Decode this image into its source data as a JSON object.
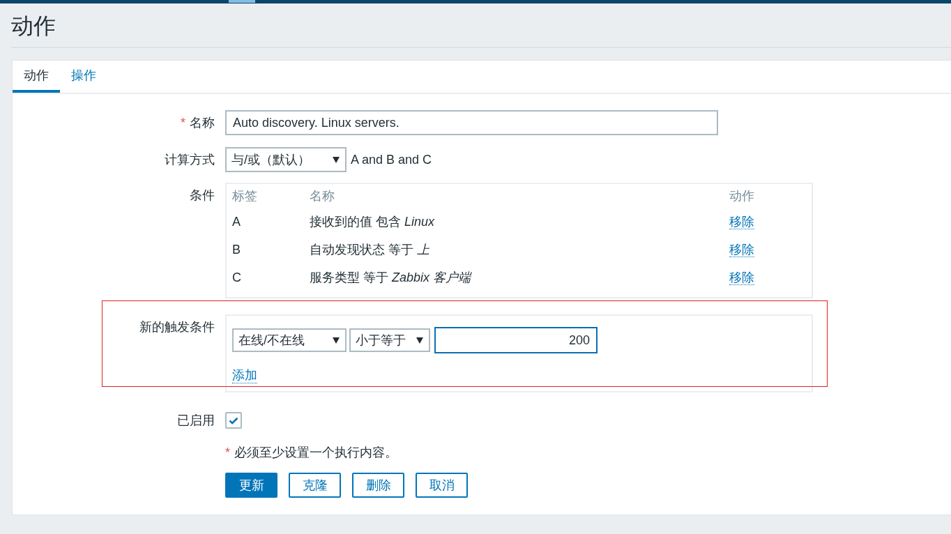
{
  "page_title": "动作",
  "tabs": [
    {
      "label": "动作",
      "selected": true
    },
    {
      "label": "操作",
      "selected": false
    }
  ],
  "form": {
    "name": {
      "required_mark": "*",
      "label": "名称",
      "value": "Auto discovery. Linux servers."
    },
    "calculation": {
      "label": "计算方式",
      "value": "与/或（默认）",
      "formula": "A and B and C"
    },
    "conditions": {
      "label": "条件",
      "columns": [
        "标签",
        "名称",
        "动作"
      ],
      "rows": [
        {
          "label": "A",
          "name": "接收到的值 包含 *Linux*",
          "action": "移除"
        },
        {
          "label": "B",
          "name": "自动发现状态 等于 *上*",
          "action": "移除"
        },
        {
          "label": "C",
          "name": "服务类型 等于 *Zabbix 客户端*",
          "action": "移除"
        }
      ]
    },
    "new_condition": {
      "label": "新的触发条件",
      "highlighted": true,
      "condition_type": "在线/不在线",
      "operator": "小于等于",
      "value": "200",
      "focused": true,
      "add_link": "添加"
    },
    "enabled": {
      "label": "已启用",
      "checked": true
    },
    "note": {
      "mark": "*",
      "text": "必须至少设置一个执行内容。"
    },
    "buttons": [
      {
        "label": "更新",
        "kind": "primary"
      },
      {
        "label": "克隆",
        "kind": "secondary"
      },
      {
        "label": "删除",
        "kind": "secondary"
      },
      {
        "label": "取消",
        "kind": "secondary"
      }
    ]
  }
}
